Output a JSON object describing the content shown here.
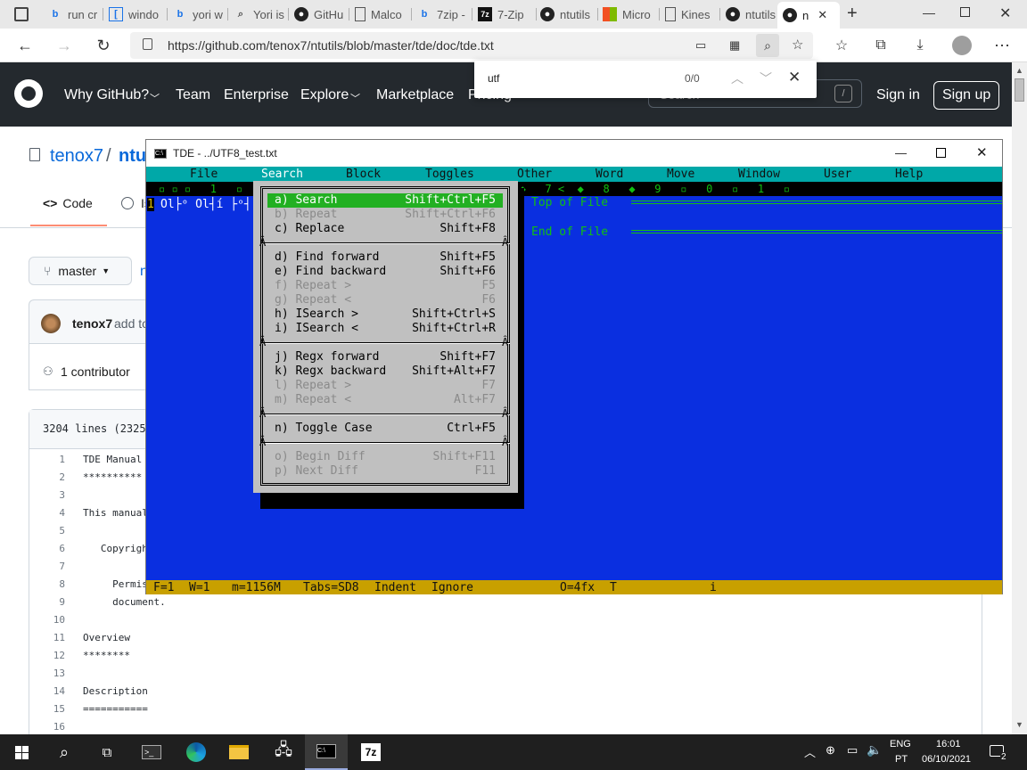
{
  "browser": {
    "tabs": [
      {
        "label": "run cr",
        "icon": "bing-icon"
      },
      {
        "label": "windo",
        "icon": "doc-icon"
      },
      {
        "label": "yori w",
        "icon": "bing-icon"
      },
      {
        "label": "Yori is",
        "icon": "search-icon"
      },
      {
        "label": "GitHu",
        "icon": "github-icon"
      },
      {
        "label": "Malco",
        "icon": "page-icon"
      },
      {
        "label": "7zip -",
        "icon": "bing-icon"
      },
      {
        "label": "7-Zip",
        "icon": "7zip-icon"
      },
      {
        "label": "ntutils",
        "icon": "github-icon"
      },
      {
        "label": "Micro",
        "icon": "microsoft-icon"
      },
      {
        "label": "Kines",
        "icon": "page-icon"
      },
      {
        "label": "ntutils",
        "icon": "github-icon"
      },
      {
        "label": "n",
        "icon": "github-icon"
      }
    ],
    "url": "https://github.com/tenox7/ntutils/blob/master/tde/doc/tde.txt",
    "find": {
      "query": "utf",
      "count": "0/0"
    }
  },
  "github": {
    "nav": [
      "Why GitHub?",
      "Team",
      "Enterprise",
      "Explore",
      "Marketplace",
      "Pricing"
    ],
    "search_placeholder": "Search",
    "search_key": "/",
    "signin": "Sign in",
    "signup": "Sign up",
    "repo_owner": "tenox7",
    "repo_sep": "/",
    "repo_name": "ntu",
    "tabs": {
      "code": "Code",
      "issues": "Is"
    },
    "branch": "master",
    "path_initial": "n",
    "author": "tenox7",
    "author_rest": "add to",
    "contributors": "1 contributor",
    "file_info": "3204 lines (2325 s",
    "lines": [
      {
        "n": "1",
        "t": "TDE Manual"
      },
      {
        "n": "2",
        "t": "**********"
      },
      {
        "n": "3",
        "t": ""
      },
      {
        "n": "4",
        "t": "This manual"
      },
      {
        "n": "5",
        "t": ""
      },
      {
        "n": "6",
        "t": "   Copyrigh"
      },
      {
        "n": "7",
        "t": ""
      },
      {
        "n": "8",
        "t": "     Permis"
      },
      {
        "n": "9",
        "t": "     document."
      },
      {
        "n": "10",
        "t": ""
      },
      {
        "n": "11",
        "t": "Overview"
      },
      {
        "n": "12",
        "t": "********"
      },
      {
        "n": "13",
        "t": ""
      },
      {
        "n": "14",
        "t": "Description"
      },
      {
        "n": "15",
        "t": "==========="
      },
      {
        "n": "16",
        "t": ""
      }
    ]
  },
  "tde": {
    "title": "TDE - ../UTF8_test.txt",
    "menu": [
      "File",
      "Search",
      "Block",
      "Toggles",
      "Other",
      "Word",
      "Move",
      "Window",
      "User",
      "Help"
    ],
    "ruler_text": "▫ ▫ ▫   1   ▫   ▫   ▫   ▫   ▫   ▫   ▫   ▫   ▫   ◆   6   ◆   7 <  ◆   8   ◆   9   ▫   0   ▫   1   ▫",
    "line_number": "1",
    "line_content": "Ol├ᵒ Ol┤í ├ᵒ┤",
    "top_of_file": "Top of File",
    "end_of_file": "End of File",
    "status": {
      "f": "F=1",
      "w": "W=1",
      "mem": "m=1156M",
      "tabs": "Tabs=SD8",
      "indent": "Indent",
      "ignore": "Ignore",
      "offset": "O=4fx",
      "t": "T",
      "i": "i"
    },
    "search_menu": [
      {
        "label": "a) Search",
        "key": "Shift+Ctrl+F5",
        "state": "selected"
      },
      {
        "label": "b) Repeat",
        "key": "Shift+Ctrl+F6",
        "state": "disabled"
      },
      {
        "label": "c) Replace",
        "key": "Shift+F8",
        "state": "normal"
      },
      {
        "label": "d) Find forward",
        "key": "Shift+F5",
        "state": "normal"
      },
      {
        "label": "e) Find backward",
        "key": "Shift+F6",
        "state": "normal"
      },
      {
        "label": "f) Repeat >",
        "key": "F5",
        "state": "disabled"
      },
      {
        "label": "g) Repeat <",
        "key": "F6",
        "state": "disabled"
      },
      {
        "label": "h) ISearch >",
        "key": "Shift+Ctrl+S",
        "state": "normal"
      },
      {
        "label": "i) ISearch <",
        "key": "Shift+Ctrl+R",
        "state": "normal"
      },
      {
        "label": "j) Regx forward",
        "key": "Shift+F7",
        "state": "normal"
      },
      {
        "label": "k) Regx backward",
        "key": "Shift+Alt+F7",
        "state": "normal"
      },
      {
        "label": "l) Repeat >",
        "key": "F7",
        "state": "disabled"
      },
      {
        "label": "m) Repeat <",
        "key": "Alt+F7",
        "state": "disabled"
      },
      {
        "label": "n) Toggle Case",
        "key": "Ctrl+F5",
        "state": "normal"
      },
      {
        "label": "o) Begin Diff",
        "key": "Shift+F11",
        "state": "disabled"
      },
      {
        "label": "p) Next Diff",
        "key": "F11",
        "state": "disabled"
      }
    ],
    "border_char": "Â"
  },
  "taskbar": {
    "lang_top": "ENG",
    "lang_bottom": "PT",
    "time": "16:01",
    "date": "06/10/2021",
    "notification_count": "2"
  },
  "colors": {
    "term_blue": "#0a2fe0",
    "menu_cyan": "#00a8a8",
    "menu_green": "#22b022",
    "status_yellow": "#c8a000",
    "github_dark": "#24292e"
  }
}
